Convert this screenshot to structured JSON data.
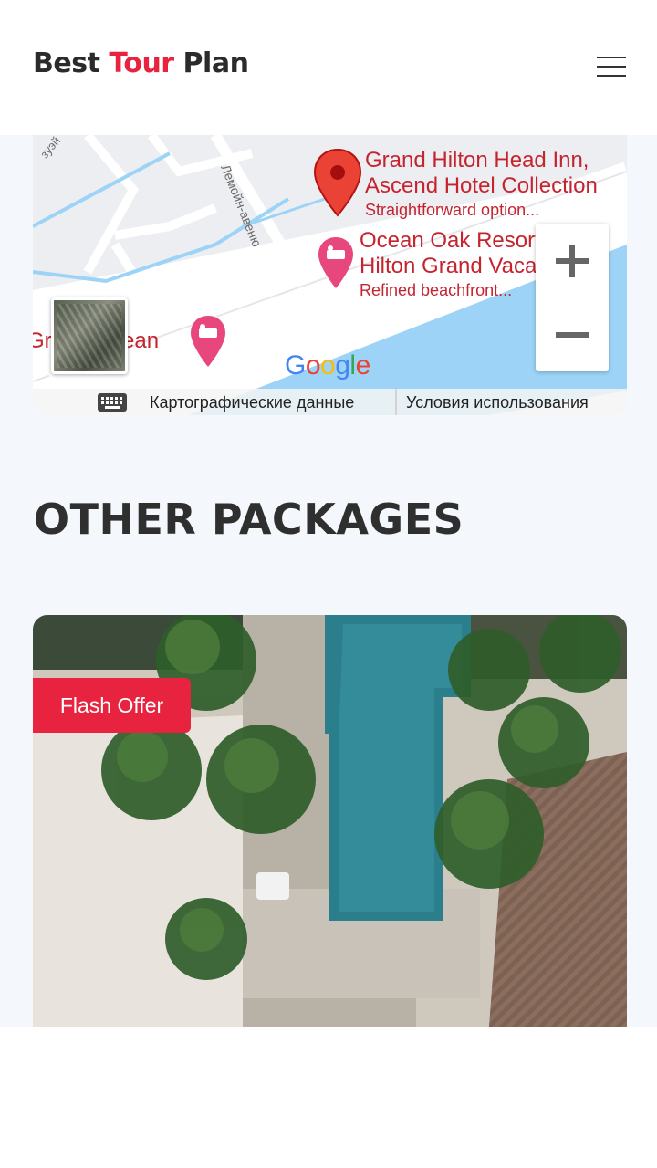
{
  "header": {
    "logo_part1": "Best ",
    "logo_accent": "Tour",
    "logo_part3": " Plan",
    "menu_icon": "hamburger-menu-icon"
  },
  "map": {
    "street_label": "Лемойн-авеню",
    "street_label_2": "зуэй",
    "places": [
      {
        "line1": "Grand Hilton Head Inn,",
        "line2": "Ascend Hotel Collection",
        "sub": "Straightforward option..."
      },
      {
        "line1": "Ocean Oak Resort",
        "line2": "Hilton Grand Vacations",
        "sub": "Refined beachfront..."
      },
      {
        "line1": "Grand Ocean"
      }
    ],
    "google_logo": [
      "G",
      "o",
      "o",
      "g",
      "l",
      "e"
    ],
    "google_colors": [
      "#4285f4",
      "#ea4335",
      "#fbbc05",
      "#4285f4",
      "#34a853",
      "#ea4335"
    ],
    "zoom_in": "+",
    "zoom_out": "−",
    "map_data_label": "Картографические данные",
    "terms_label": "Условия использования",
    "keyboard_icon": "keyboard-icon"
  },
  "section_title": "OTHER PACKAGES",
  "card": {
    "badge": "Flash Offer"
  },
  "colors": {
    "accent": "#e8233f",
    "page_bg": "#f4f8fd",
    "text_dark": "#2f2f2f"
  }
}
